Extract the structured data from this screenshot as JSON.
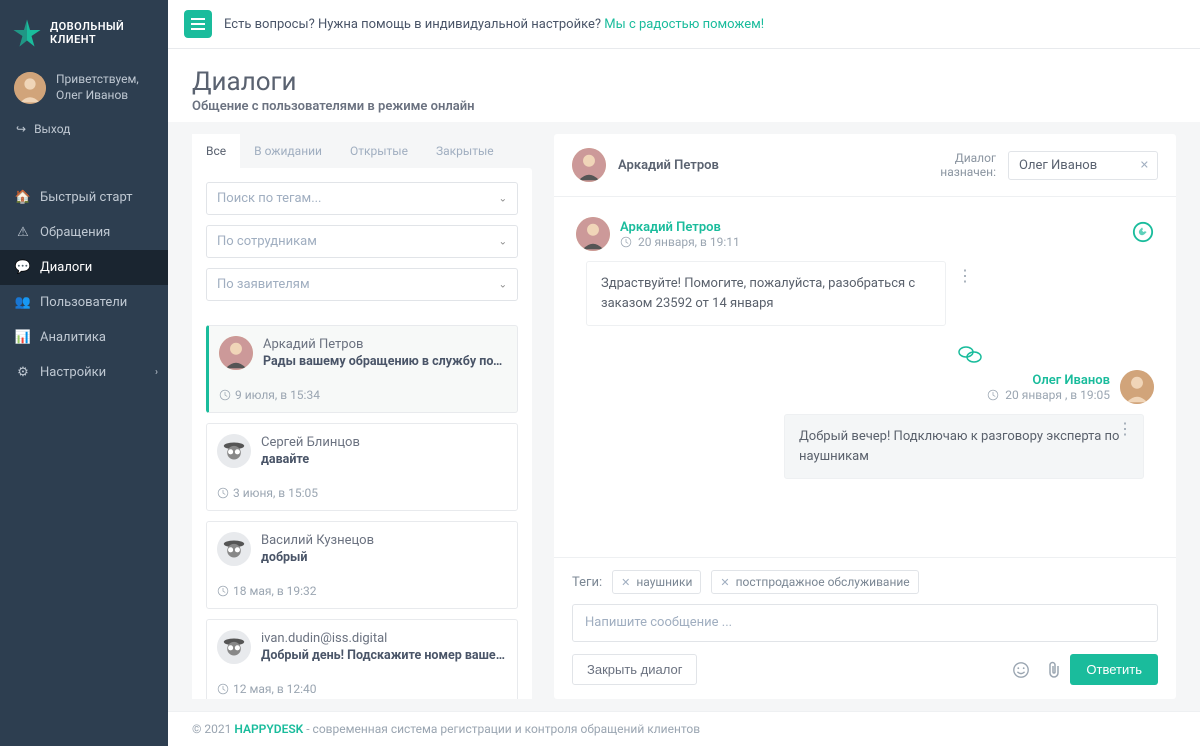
{
  "brand": {
    "line1": "ДОВОЛЬНЫЙ",
    "line2": "КЛИЕНТ"
  },
  "user": {
    "greeting": "Приветствуем,",
    "name": "Олег Иванов",
    "logout": "Выход"
  },
  "nav": {
    "items": [
      {
        "label": "Быстрый старт"
      },
      {
        "label": "Обращения"
      },
      {
        "label": "Диалоги"
      },
      {
        "label": "Пользователи"
      },
      {
        "label": "Аналитика"
      },
      {
        "label": "Настройки"
      }
    ]
  },
  "banner": {
    "prefix": "Есть вопросы? Нужна помощь в индивидуальной настройке? ",
    "link": "Мы с радостью поможем!"
  },
  "page": {
    "title": "Диалоги",
    "subtitle": "Общение с пользователями в режиме онлайн"
  },
  "tabs": {
    "all": "Все",
    "waiting": "В ожидании",
    "open": "Открытые",
    "closed": "Закрытые"
  },
  "filters": {
    "tags_ph": "Поиск по тегам...",
    "staff_ph": "По сотрудникам",
    "requesters_ph": "По заявителям"
  },
  "dialogs": [
    {
      "name": "Аркадий Петров",
      "preview": "Рады вашему обращению в службу подде...",
      "time": "9 июля, в 15:34"
    },
    {
      "name": "Сергей Блинцов",
      "preview": "давайте",
      "time": "3 июня, в 15:05"
    },
    {
      "name": "Василий Кузнецов",
      "preview": "добрый",
      "time": "18 мая, в 19:32"
    },
    {
      "name": "ivan.dudin@iss.digital",
      "preview": "Добрый день! Подскажите номер вашего ...",
      "time": "12 мая, в 12:40"
    }
  ],
  "conversation": {
    "contact": "Аркадий Петров",
    "assigned_label_1": "Диалог",
    "assigned_label_2": "назначен:",
    "assigned_to": "Олег Иванов",
    "messages": [
      {
        "author": "Аркадий Петров",
        "time": "20 января, в 19:11",
        "text": "Здраствуйте!   Помогите, пожалуйста, разобраться с заказом 23592 от 14 января"
      },
      {
        "author": "Олег Иванов",
        "time": "20 января , в 19:05",
        "text": "Добрый вечер! Подключаю к разговору эксперта по наушникам"
      }
    ],
    "tags_label": "Теги:",
    "tags": [
      "наушники",
      "постпродажное обслуживание"
    ],
    "compose_ph": "Напишите сообщение ...",
    "close_btn": "Закрыть диалог",
    "reply_btn": "Ответить"
  },
  "footer": {
    "year": "© 2021 ",
    "brand": "HAPPYDESK",
    "text": " - современная система регистрации и  контроля обращений клиентов"
  }
}
